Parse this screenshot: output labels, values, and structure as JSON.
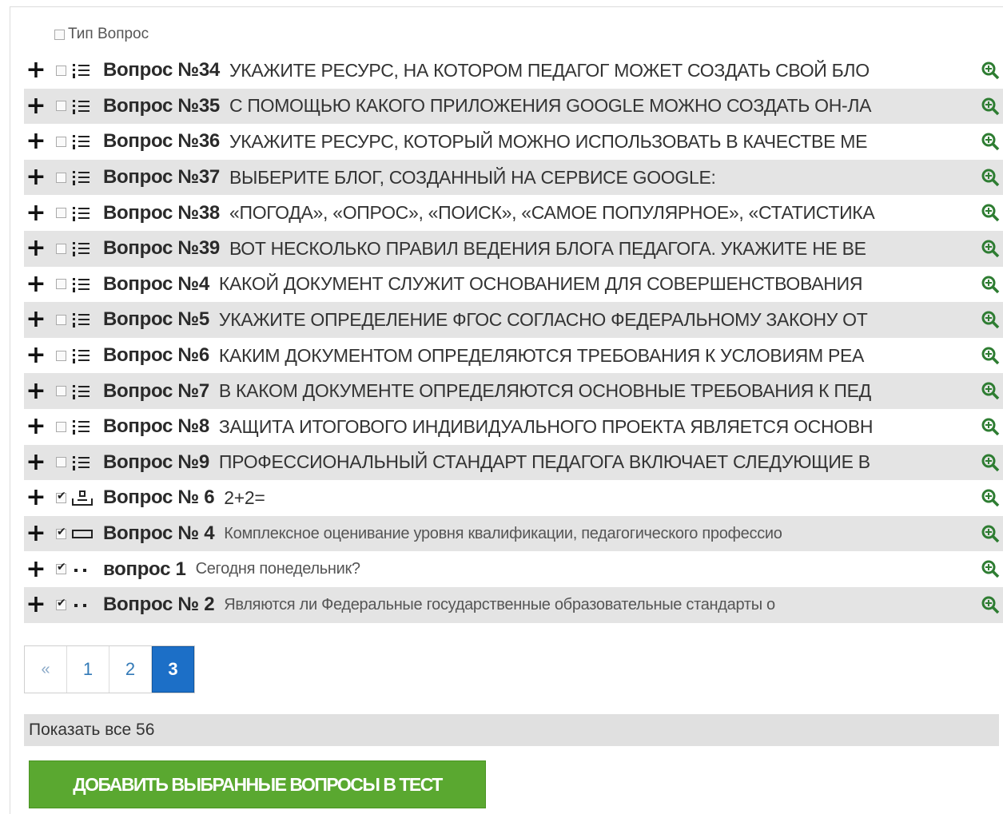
{
  "header": {
    "label": "Тип Вопрос"
  },
  "rows": [
    {
      "label": "Вопрос №34",
      "text": "УКАЖИТЕ РЕСУРС, НА КОТОРОМ ПЕДАГОГ МОЖЕТ СОЗДАТЬ СВОЙ БЛО",
      "checked": false,
      "type_icon": "list-icon",
      "shaded": false,
      "lower": false
    },
    {
      "label": "Вопрос №35",
      "text": "С ПОМОЩЬЮ КАКОГО ПРИЛОЖЕНИЯ GOOGLE МОЖНО СОЗДАТЬ ОН-ЛА",
      "checked": false,
      "type_icon": "list-icon",
      "shaded": true,
      "lower": false
    },
    {
      "label": "Вопрос №36",
      "text": "УКАЖИТЕ РЕСУРС, КОТОРЫЙ МОЖНО ИСПОЛЬЗОВАТЬ В КАЧЕСТВЕ МЕ",
      "checked": false,
      "type_icon": "list-icon",
      "shaded": false,
      "lower": false
    },
    {
      "label": "Вопрос №37",
      "text": "ВЫБЕРИТЕ БЛОГ, СОЗДАННЫЙ НА СЕРВИСЕ GOOGLE:",
      "checked": false,
      "type_icon": "list-icon",
      "shaded": true,
      "lower": false
    },
    {
      "label": "Вопрос №38",
      "text": "«ПОГОДА», «ОПРОС», «ПОИСК», «САМОЕ ПОПУЛЯРНОЕ», «СТАТИСТИКА",
      "checked": false,
      "type_icon": "list-icon",
      "shaded": false,
      "lower": false
    },
    {
      "label": "Вопрос №39",
      "text": "ВОТ НЕСКОЛЬКО ПРАВИЛ ВЕДЕНИЯ БЛОГА ПЕДАГОГА. УКАЖИТЕ НЕ ВЕ",
      "checked": false,
      "type_icon": "list-icon",
      "shaded": true,
      "lower": false
    },
    {
      "label": "Вопрос №4",
      "text": "КАКОЙ ДОКУМЕНТ СЛУЖИТ ОСНОВАНИЕМ ДЛЯ СОВЕРШЕНСТВОВАНИЯ",
      "checked": false,
      "type_icon": "list-icon",
      "shaded": false,
      "lower": false
    },
    {
      "label": "Вопрос №5",
      "text": "УКАЖИТЕ ОПРЕДЕЛЕНИЕ ФГОС СОГЛАСНО ФЕДЕРАЛЬНОМУ ЗАКОНУ ОТ",
      "checked": false,
      "type_icon": "list-icon",
      "shaded": true,
      "lower": false
    },
    {
      "label": "Вопрос №6",
      "text": "КАКИМ ДОКУМЕНТОМ ОПРЕДЕЛЯЮТСЯ ТРЕБОВАНИЯ К УСЛОВИЯМ РЕА",
      "checked": false,
      "type_icon": "list-icon",
      "shaded": false,
      "lower": false
    },
    {
      "label": "Вопрос №7",
      "text": "В КАКОМ ДОКУМЕНТЕ ОПРЕДЕЛЯЮТСЯ ОСНОВНЫЕ ТРЕБОВАНИЯ К ПЕД",
      "checked": false,
      "type_icon": "list-icon",
      "shaded": true,
      "lower": false
    },
    {
      "label": "Вопрос №8",
      "text": "ЗАЩИТА ИТОГОВОГО ИНДИВИДУАЛЬНОГО ПРОЕКТА ЯВЛЯЕТСЯ ОСНОВН",
      "checked": false,
      "type_icon": "list-icon",
      "shaded": false,
      "lower": false
    },
    {
      "label": "Вопрос №9",
      "text": "ПРОФЕССИОНАЛЬНЫЙ СТАНДАРТ ПЕДАГОГА ВКЛЮЧАЕТ СЛЕДУЮЩИЕ В",
      "checked": false,
      "type_icon": "list-icon",
      "shaded": true,
      "lower": false
    },
    {
      "label": "Вопрос № 6",
      "text": "2+2=",
      "checked": true,
      "type_icon": "input-tray-icon",
      "shaded": false,
      "lower": false
    },
    {
      "label": "Вопрос № 4",
      "text": "Комплексное оценивание уровня квалификации, педагогического профессио",
      "checked": true,
      "type_icon": "text-field-icon",
      "shaded": true,
      "lower": true
    },
    {
      "label": "вопрос 1",
      "text": "Сегодня понедельник?",
      "checked": true,
      "type_icon": "dots-icon",
      "shaded": false,
      "lower": true
    },
    {
      "label": "Вопрос № 2",
      "text": "Являются ли Федеральные государственные образовательные стандарты  о",
      "checked": true,
      "type_icon": "dots-icon",
      "shaded": true,
      "lower": true
    }
  ],
  "pagination": {
    "prev": "«",
    "pages": [
      "1",
      "2",
      "3"
    ],
    "active": "3"
  },
  "show_all": "Показать все 56",
  "add_button": "ДОБАВИТЬ ВЫБРАННЫЕ ВОПРОСЫ В ТЕСТ",
  "colors": {
    "zoom_icon": "#2e7d32",
    "add_button": "#5aa830",
    "active_page": "#1c6fc7"
  }
}
